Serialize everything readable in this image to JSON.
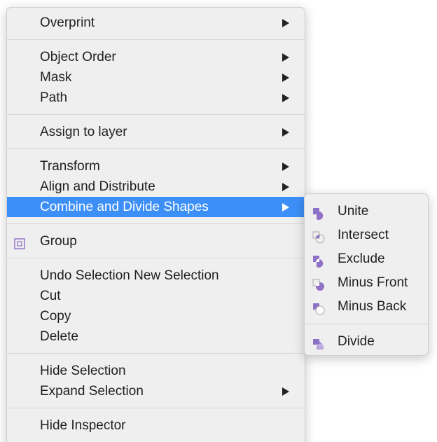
{
  "context_menu": {
    "overprint": "Overprint",
    "object_order": "Object Order",
    "mask": "Mask",
    "path": "Path",
    "assign_to_layer": "Assign to layer",
    "transform": "Transform",
    "align_and_distribute": "Align and Distribute",
    "combine_and_divide_shapes": "Combine and Divide Shapes",
    "group": "Group",
    "undo_selection": "Undo Selection New Selection",
    "cut": "Cut",
    "copy": "Copy",
    "delete": "Delete",
    "hide_selection": "Hide Selection",
    "expand_selection": "Expand Selection",
    "hide_inspector": "Hide Inspector"
  },
  "submenu": {
    "unite": "Unite",
    "intersect": "Intersect",
    "exclude": "Exclude",
    "minus_front": "Minus Front",
    "minus_back": "Minus Back",
    "divide": "Divide"
  },
  "icons": {
    "group": "group-icon",
    "unite": "unite-icon",
    "intersect": "intersect-icon",
    "exclude": "exclude-icon",
    "minus_front": "minus-front-icon",
    "minus_back": "minus-back-icon",
    "divide": "divide-icon",
    "submenu_arrow": "chevron-right-icon"
  },
  "colors": {
    "highlight": "#3d8ff8",
    "menu_background": "#efefef",
    "shape_purple": "#8d72c8",
    "shape_light": "#ffffff"
  }
}
